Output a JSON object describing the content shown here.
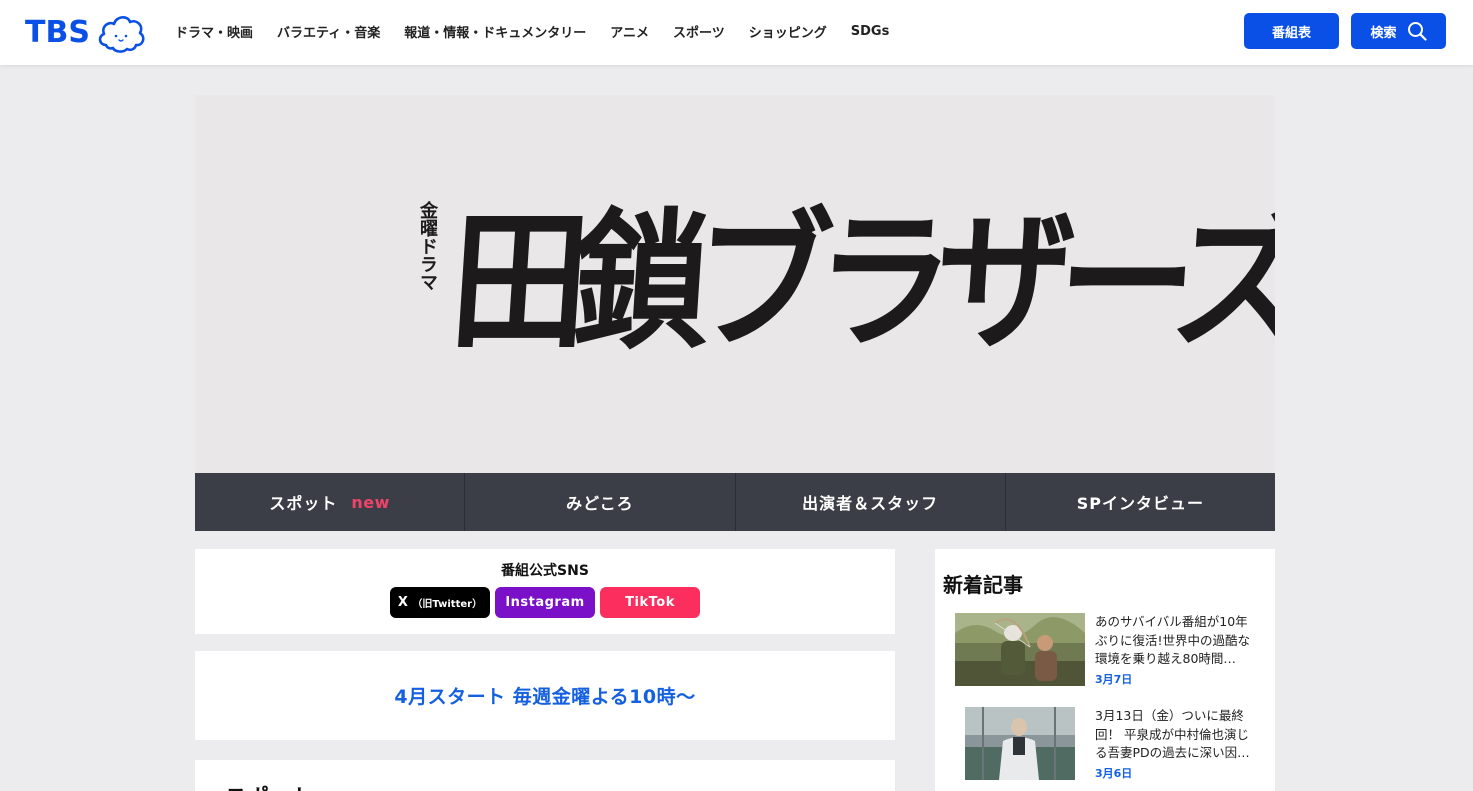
{
  "header": {
    "logo_text": "TBS",
    "nav": [
      "ドラマ・映画",
      "バラエティ・音楽",
      "報道・情報・ドキュメンタリー",
      "アニメ",
      "スポーツ",
      "ショッピング",
      "SDGs"
    ],
    "schedule_label": "番組表",
    "search_label": "検索"
  },
  "hero": {
    "subtitle": "金曜ドラマ",
    "title": "田鎖ブラザーズ"
  },
  "program_nav": [
    {
      "label": "スポット",
      "badge": "new"
    },
    {
      "label": "みどころ"
    },
    {
      "label": "出演者＆スタッフ"
    },
    {
      "label": "SPインタビュー"
    }
  ],
  "sns": {
    "title": "番組公式SNS",
    "x_label": "X",
    "x_note": "（旧Twitter）",
    "instagram_label": "Instagram",
    "tiktok_label": "TikTok"
  },
  "broadcast": {
    "start_text": "4月スタート 毎週金曜よる10時〜"
  },
  "spot": {
    "title": "スポット"
  },
  "sidebar": {
    "title": "新着記事",
    "articles": [
      {
        "text": "あのサバイバル番組が10年ぶりに復活!世界中の過酷な環境を乗り越え80時間…",
        "date": "3月7日"
      },
      {
        "text": "3月13日（金）ついに最終回！ 平泉成が中村倫也演じる吾妻PDの過去に深い因…",
        "date": "3月6日"
      }
    ]
  },
  "colors": {
    "brand_blue": "#0a50e6",
    "nav_dark": "#3b3e46",
    "new_pink": "#f0436a",
    "instagram": "#7a11c8",
    "tiktok": "#fb2e5e",
    "link_blue": "#1460e0"
  }
}
